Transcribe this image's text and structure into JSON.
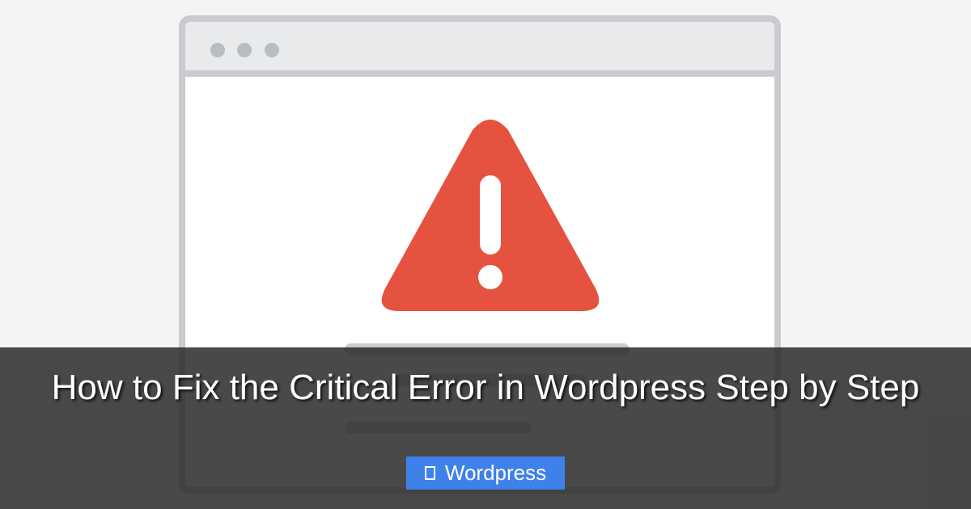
{
  "article": {
    "title": "How to Fix the Critical Error in Wordpress Step by Step"
  },
  "category": {
    "label": "Wordpress",
    "icon": "folder-icon"
  },
  "illustration": {
    "icon": "warning-triangle-icon",
    "colors": {
      "warning_red": "#e5523f",
      "window_frame": "#c9cbcf",
      "badge_blue": "#3f81ea"
    }
  }
}
